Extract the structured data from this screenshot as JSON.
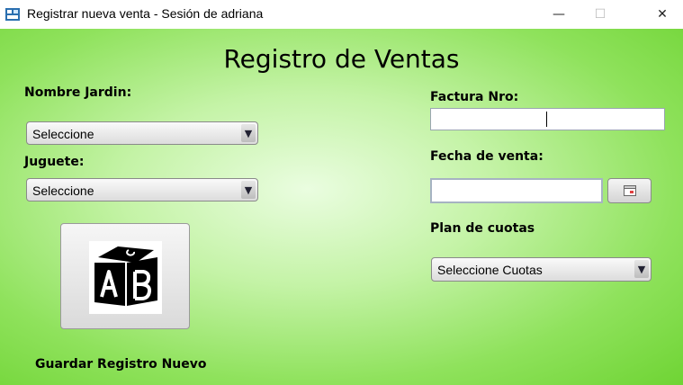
{
  "window": {
    "title": "Registrar nueva venta - Sesión de adriana",
    "minimize_glyph": "—",
    "maximize_glyph": "☐",
    "close_glyph": "✕"
  },
  "form": {
    "heading": "Registro de Ventas",
    "nombre_jardin": {
      "label": "Nombre Jardin:",
      "selected": "Seleccione"
    },
    "juguete": {
      "label": "Juguete:",
      "selected": "Seleccione"
    },
    "factura": {
      "label": "Factura Nro:",
      "value": ""
    },
    "fecha": {
      "label": "Fecha de venta:",
      "value": "",
      "button_icon": "calendar-icon"
    },
    "plan_cuotas": {
      "label": "Plan de cuotas",
      "selected": "Seleccione Cuotas"
    },
    "save_button": {
      "icon": "abc-blocks-icon",
      "caption": "Guardar Registro Nuevo"
    }
  },
  "colors": {
    "background_center": "#eafde0",
    "background_edge": "#6fd434",
    "combo_arrow": "#223344"
  },
  "glyphs": {
    "dropdown_arrow": "▼"
  }
}
